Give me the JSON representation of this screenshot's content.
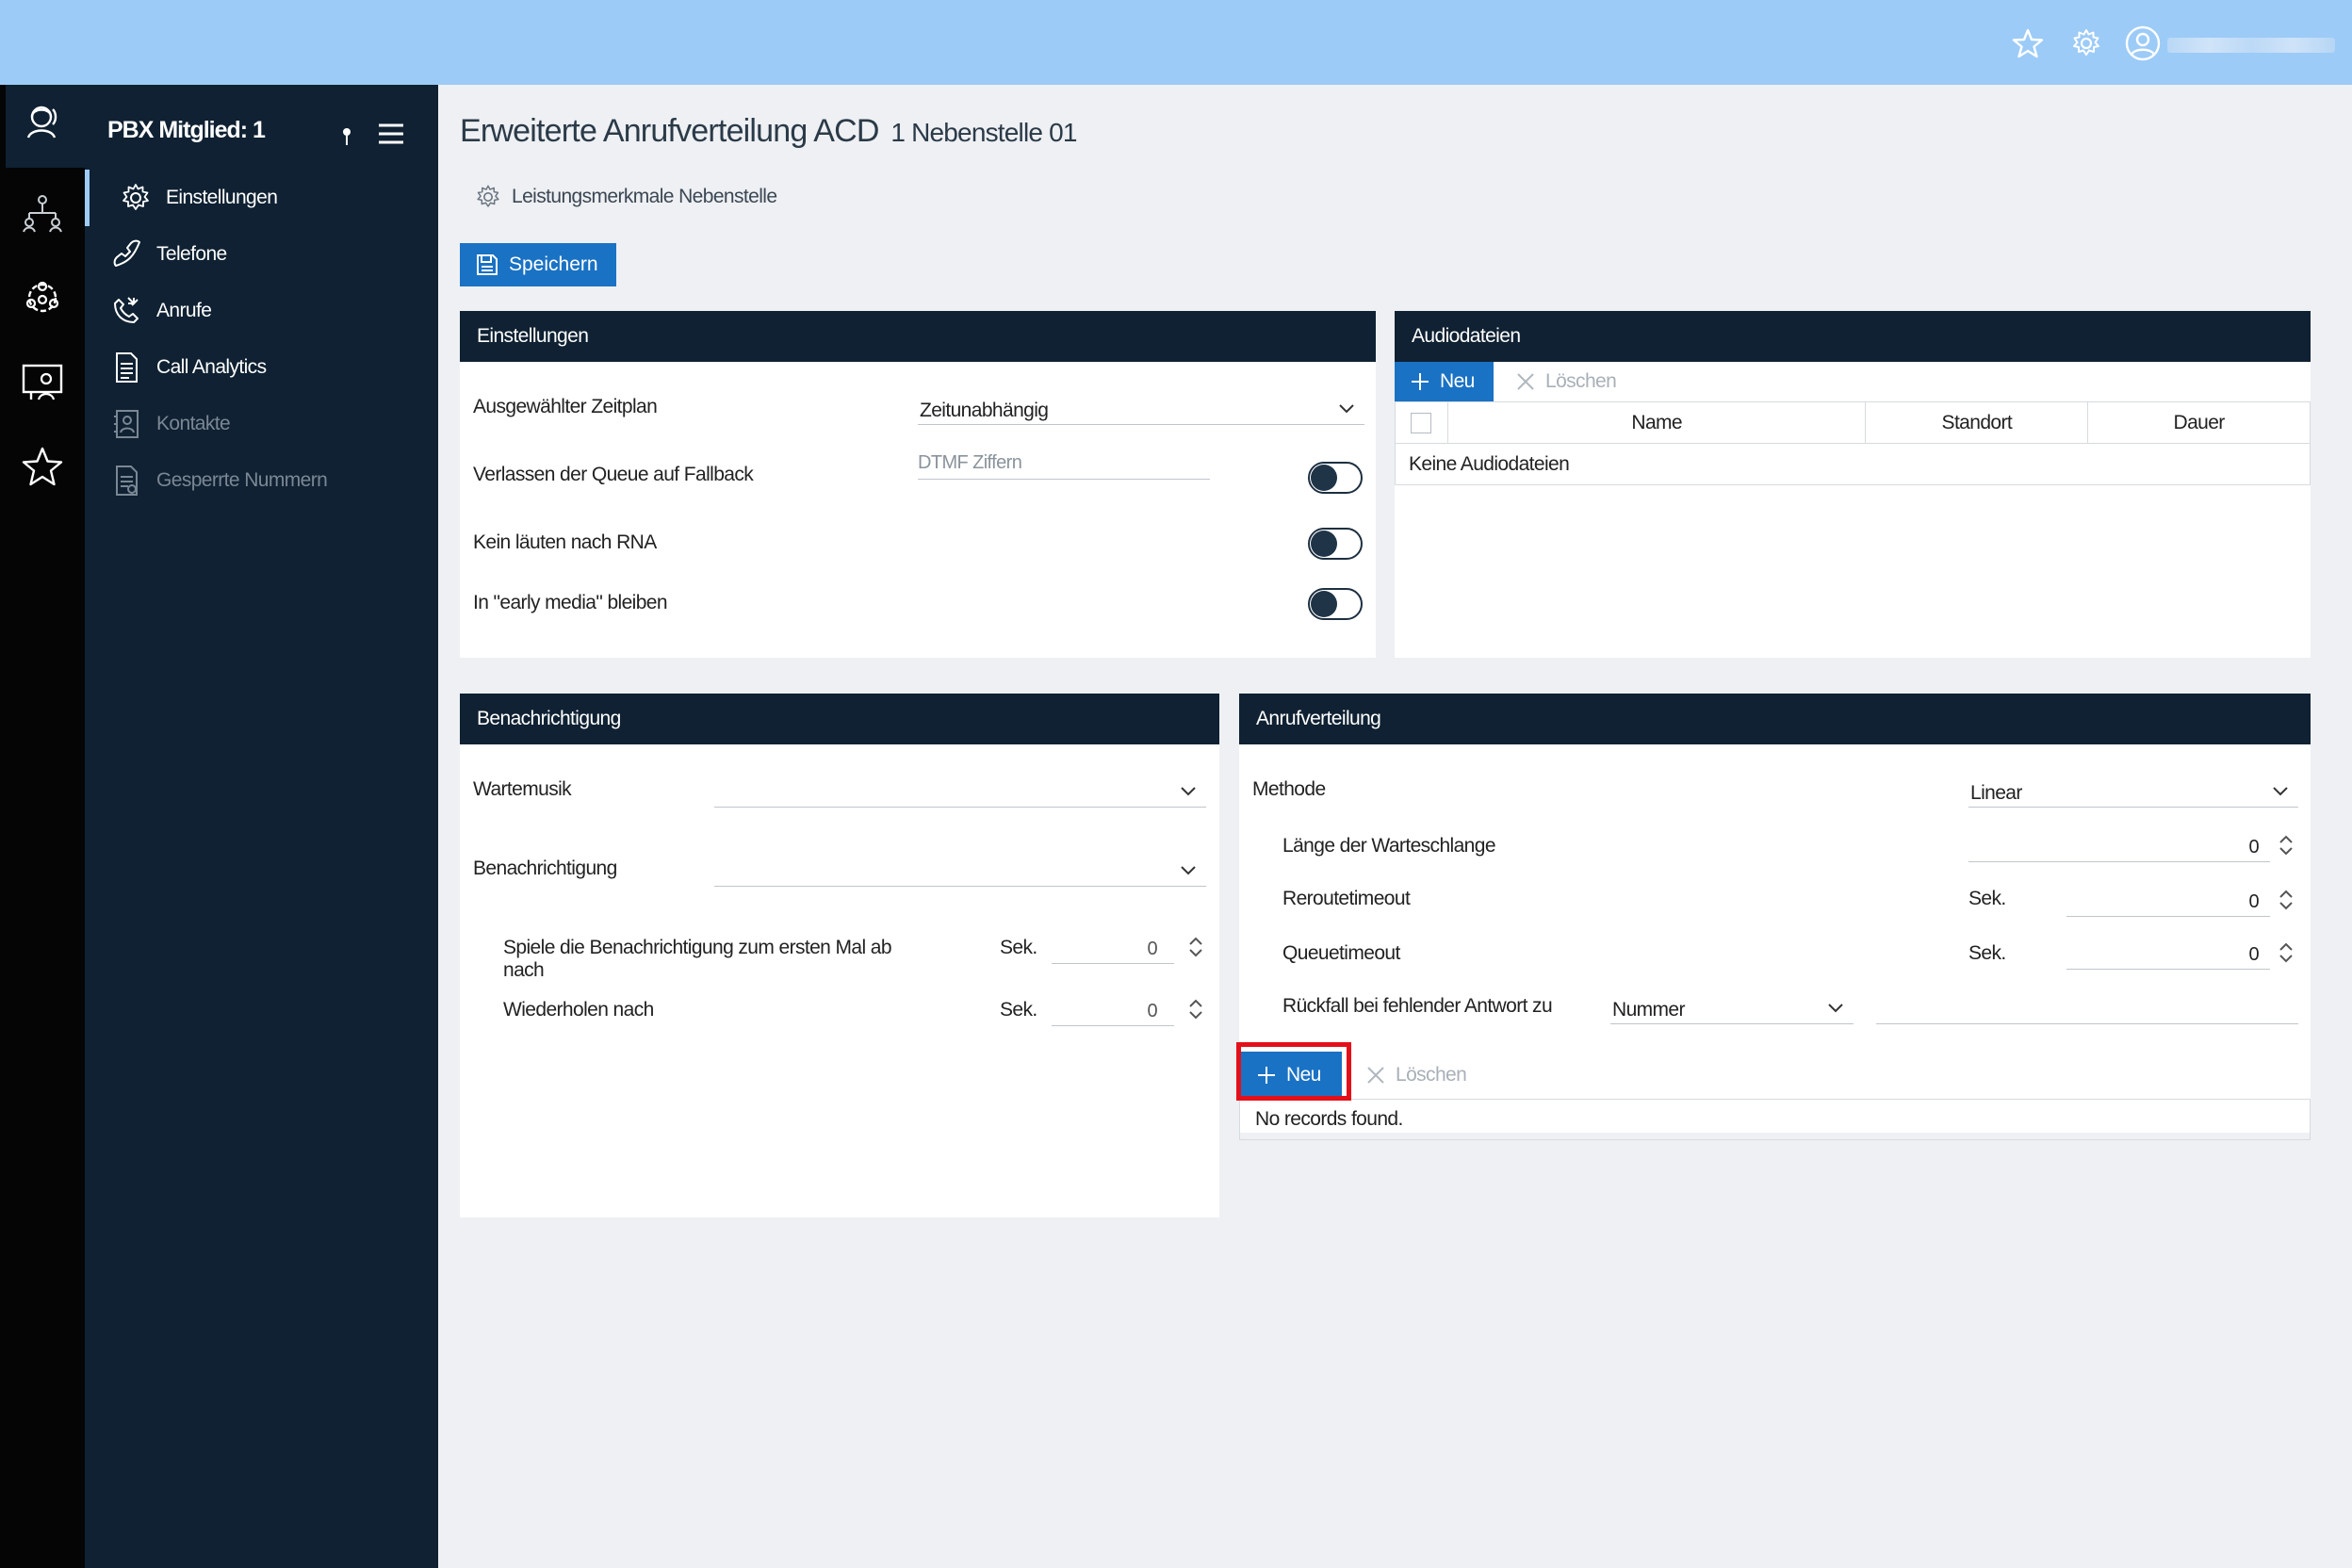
{
  "topbar": {
    "icons": [
      "star-icon",
      "gear-icon",
      "user-icon"
    ],
    "user_name_obscured": true
  },
  "rail": {
    "icons": [
      "headset-user-icon",
      "org-chart-icon",
      "group-gear-icon",
      "monitor-user-icon",
      "star-icon"
    ]
  },
  "sidebar": {
    "title": "PBX Mitglied: 1",
    "items": [
      {
        "label": "Einstellungen",
        "icon": "gear-icon",
        "active": true,
        "disabled": false
      },
      {
        "label": "Telefone",
        "icon": "phone-icon",
        "active": false,
        "disabled": false
      },
      {
        "label": "Anrufe",
        "icon": "phone-arrows-icon",
        "active": false,
        "disabled": false
      },
      {
        "label": "Call Analytics",
        "icon": "document-icon",
        "active": false,
        "disabled": false
      },
      {
        "label": "Kontakte",
        "icon": "contacts-icon",
        "active": false,
        "disabled": true
      },
      {
        "label": "Gesperrte Nummern",
        "icon": "blocked-document-icon",
        "active": false,
        "disabled": true
      }
    ]
  },
  "page": {
    "title": "Erweiterte Anrufverteilung ACD",
    "title_sub": "1 Nebenstelle 01",
    "subtitle": "Leistungsmerkmale Nebenstelle",
    "save_label": "Speichern"
  },
  "einstellungen": {
    "header": "Einstellungen",
    "zeitplan_label": "Ausgewählter Zeitplan",
    "zeitplan_value": "Zeitunabhängig",
    "fallback_label": "Verlassen der Queue auf Fallback",
    "fallback_placeholder": "DTMF Ziffern",
    "rna_label": "Kein läuten nach RNA",
    "early_media_label": "In \"early media\" bleiben"
  },
  "audiodateien": {
    "header": "Audiodateien",
    "new_label": "Neu",
    "delete_label": "Löschen",
    "columns": [
      "Name",
      "Standort",
      "Dauer"
    ],
    "empty_text": "Keine Audiodateien"
  },
  "benachrichtigung": {
    "header": "Benachrichtigung",
    "wartemusik_label": "Wartemusik",
    "wartemusik_value": "",
    "benachrichtigung_label": "Benachrichtigung",
    "benachrichtigung_value": "",
    "first_play_label": "Spiele die Benachrichtigung zum ersten Mal ab nach",
    "first_play_unit": "Sek.",
    "first_play_value": "0",
    "repeat_label": "Wiederholen nach",
    "repeat_unit": "Sek.",
    "repeat_value": "0"
  },
  "anrufverteilung": {
    "header": "Anrufverteilung",
    "methode_label": "Methode",
    "methode_value": "Linear",
    "queue_length_label": "Länge der Warteschlange",
    "queue_length_value": "0",
    "reroute_label": "Reroutetimeout",
    "reroute_unit": "Sek.",
    "reroute_value": "0",
    "queue_timeout_label": "Queuetimeout",
    "queue_timeout_unit": "Sek.",
    "queue_timeout_value": "0",
    "fallback_label": "Rückfall bei fehlender Antwort zu",
    "fallback_value": "Nummer",
    "fallback_number": "",
    "new_label": "Neu",
    "delete_label": "Löschen",
    "empty_text": "No records found."
  },
  "colors": {
    "topbar": "#9ccbf7",
    "sidebar": "#0f2132",
    "accent": "#1a72c4",
    "highlight": "#e3101a"
  }
}
